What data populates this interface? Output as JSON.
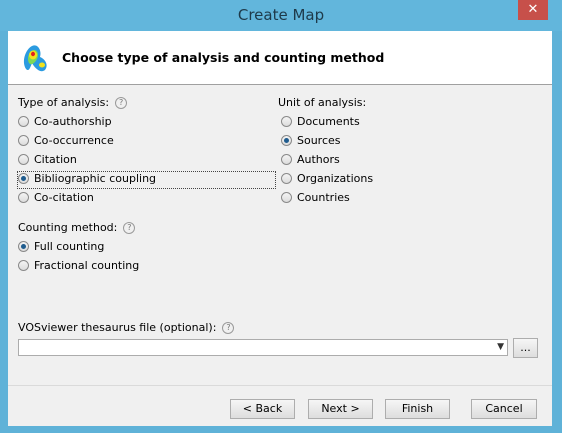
{
  "window": {
    "title": "Create Map",
    "close_glyph": "✕"
  },
  "header": {
    "title": "Choose type of analysis and counting method",
    "icon": "vosviewer-logo-icon"
  },
  "analysis": {
    "label": "Type of analysis:",
    "options": [
      {
        "label": "Co-authorship",
        "checked": false
      },
      {
        "label": "Co-occurrence",
        "checked": false
      },
      {
        "label": "Citation",
        "checked": false
      },
      {
        "label": "Bibliographic coupling",
        "checked": true
      },
      {
        "label": "Co-citation",
        "checked": false
      }
    ]
  },
  "unit": {
    "label": "Unit of analysis:",
    "options": [
      {
        "label": "Documents",
        "checked": false
      },
      {
        "label": "Sources",
        "checked": true
      },
      {
        "label": "Authors",
        "checked": false
      },
      {
        "label": "Organizations",
        "checked": false
      },
      {
        "label": "Countries",
        "checked": false
      }
    ]
  },
  "counting": {
    "label": "Counting method:",
    "options": [
      {
        "label": "Full counting",
        "checked": true
      },
      {
        "label": "Fractional counting",
        "checked": false
      }
    ]
  },
  "thesaurus": {
    "label": "VOSviewer thesaurus file (optional):",
    "value": "",
    "browse_label": "..."
  },
  "help_glyph": "?",
  "footer": {
    "back": "< Back",
    "next": "Next >",
    "finish": "Finish",
    "cancel": "Cancel"
  }
}
